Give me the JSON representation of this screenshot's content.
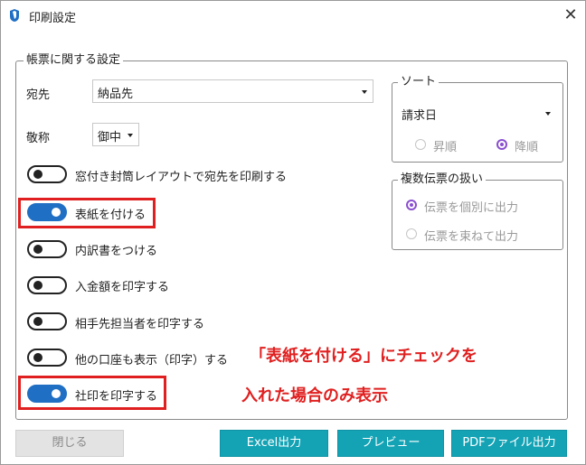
{
  "window": {
    "title": "印刷設定",
    "close_glyph": "✕"
  },
  "colors": {
    "accent_toggle": "#1f6fc4",
    "radio_selected": "#8a4fd0",
    "annotation": "#e02020",
    "primary_button": "#13a3b5"
  },
  "main_group": {
    "legend": "帳票に関する設定",
    "destination": {
      "label": "宛先",
      "value": "納品先"
    },
    "honorific": {
      "label": "敬称",
      "value": "御中"
    },
    "toggles": [
      {
        "label": "窓付き封筒レイアウトで宛先を印刷する",
        "on": false
      },
      {
        "label": "表紙を付ける",
        "on": true
      },
      {
        "label": "内訳書をつける",
        "on": false
      },
      {
        "label": "入金額を印字する",
        "on": false
      },
      {
        "label": "相手先担当者を印字する",
        "on": false
      },
      {
        "label": "他の口座も表示（印字）する",
        "on": false
      },
      {
        "label": "社印を印字する",
        "on": true
      }
    ]
  },
  "sort_group": {
    "legend": "ソート",
    "value": "請求日",
    "options": [
      {
        "label": "昇順",
        "selected": false
      },
      {
        "label": "降順",
        "selected": true
      }
    ]
  },
  "multi_group": {
    "legend": "複数伝票の扱い",
    "options": [
      {
        "label": "伝票を個別に出力",
        "selected": true
      },
      {
        "label": "伝票を束ねて出力",
        "selected": false
      }
    ]
  },
  "annotation": {
    "line1": "「表紙を付ける」にチェックを",
    "line2": "入れた場合のみ表示"
  },
  "buttons": {
    "close": "閉じる",
    "excel": "Excel出力",
    "preview": "プレビュー",
    "pdf": "PDFファイル出力"
  }
}
